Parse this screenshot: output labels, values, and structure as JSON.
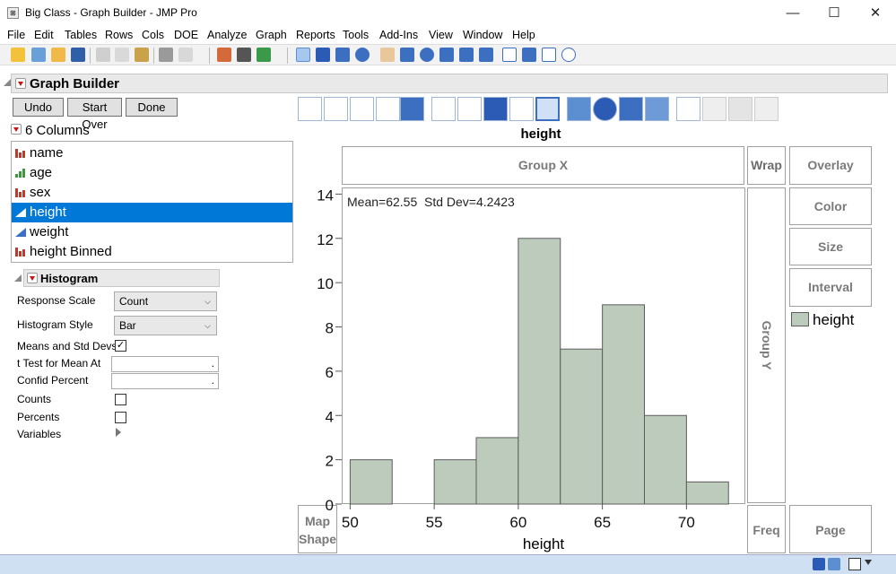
{
  "window": {
    "title": "Big Class - Graph Builder - JMP Pro"
  },
  "menu": [
    "File",
    "Edit",
    "Tables",
    "Rows",
    "Cols",
    "DOE",
    "Analyze",
    "Graph",
    "Reports",
    "Tools",
    "Add-Ins",
    "View",
    "Window",
    "Help"
  ],
  "graph_builder": {
    "title": "Graph Builder",
    "undo": "Undo",
    "start_over": "Start Over",
    "done": "Done",
    "columns_header": "6 Columns",
    "columns": [
      {
        "name": "name",
        "type": "nominal"
      },
      {
        "name": "age",
        "type": "ordinal"
      },
      {
        "name": "sex",
        "type": "nominal"
      },
      {
        "name": "height",
        "type": "continuous",
        "selected": true
      },
      {
        "name": "weight",
        "type": "continuous"
      },
      {
        "name": "height Binned",
        "type": "nominal"
      }
    ]
  },
  "histogram_panel": {
    "title": "Histogram",
    "response_scale_label": "Response Scale",
    "response_scale_value": "Count",
    "histogram_style_label": "Histogram Style",
    "histogram_style_value": "Bar",
    "means_std_label": "Means and Std Devs",
    "means_std_checked": true,
    "ttest_label": "t Test for Mean At",
    "ttest_value": ".",
    "confid_label": "Confid Percent",
    "confid_value": ".",
    "counts_label": "Counts",
    "counts_checked": false,
    "percents_label": "Percents",
    "percents_checked": false,
    "variables_label": "Variables"
  },
  "zones": {
    "group_x": "Group X",
    "wrap": "Wrap",
    "overlay": "Overlay",
    "color": "Color",
    "size": "Size",
    "interval": "Interval",
    "group_y": "Group Y",
    "map_shape_1": "Map",
    "map_shape_2": "Shape",
    "freq": "Freq",
    "page": "Page"
  },
  "colors": {
    "bar_fill": "#bccbbc",
    "bar_stroke": "#5c5c5c",
    "selection": "#0078d7"
  },
  "chart_data": {
    "type": "bar",
    "title": "height",
    "xlabel": "height",
    "ylabel": "",
    "annotation": "Mean=62.55  Std Dev=4.2423",
    "legend": [
      "height"
    ],
    "bins": [
      {
        "x0": 50,
        "x1": 52.5,
        "count": 2
      },
      {
        "x0": 52.5,
        "x1": 55,
        "count": 0
      },
      {
        "x0": 55,
        "x1": 57.5,
        "count": 2
      },
      {
        "x0": 57.5,
        "x1": 60,
        "count": 3
      },
      {
        "x0": 60,
        "x1": 62.5,
        "count": 12
      },
      {
        "x0": 62.5,
        "x1": 65,
        "count": 7
      },
      {
        "x0": 65,
        "x1": 67.5,
        "count": 9
      },
      {
        "x0": 67.5,
        "x1": 70,
        "count": 4
      },
      {
        "x0": 70,
        "x1": 72.5,
        "count": 1
      }
    ],
    "xticks": [
      50,
      55,
      60,
      65,
      70
    ],
    "yticks": [
      0,
      2,
      4,
      6,
      8,
      10,
      12,
      14
    ],
    "xlim": [
      49.5,
      73.5
    ],
    "ylim": [
      0,
      14.3
    ]
  }
}
